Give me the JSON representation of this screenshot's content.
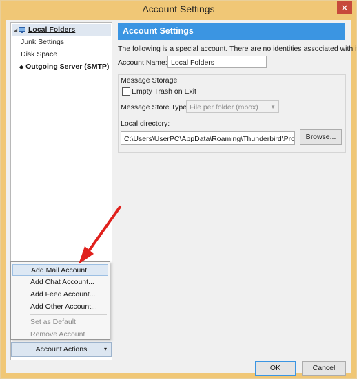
{
  "window": {
    "title": "Account Settings",
    "close_glyph": "✕"
  },
  "tree": {
    "items": [
      {
        "label": "Local Folders",
        "icon": "local-folder-icon"
      },
      {
        "label": "Junk Settings"
      },
      {
        "label": "Disk Space"
      },
      {
        "label": "Outgoing Server (SMTP)"
      }
    ],
    "twisty": "◢"
  },
  "menu": {
    "items": [
      {
        "label": "Add Mail Account..."
      },
      {
        "label": "Add Chat Account..."
      },
      {
        "label": "Add Feed Account..."
      },
      {
        "label": "Add Other Account..."
      },
      {
        "label": "Set as Default"
      },
      {
        "label": "Remove Account"
      }
    ]
  },
  "account_actions": {
    "label": "Account Actions",
    "arrow": "▾"
  },
  "panel": {
    "header": "Account Settings",
    "description": "The following is a special account. There are no identities associated with it.",
    "account_name_label": "Account Name:",
    "account_name_value": "Local Folders",
    "message_storage_label": "Message Storage",
    "empty_trash_label": "Empty Trash on Exit",
    "store_type_label": "Message Store Type:",
    "store_type_value": "File per folder (mbox)",
    "local_directory_label": "Local directory:",
    "local_directory_value": "C:\\Users\\UserPC\\AppData\\Roaming\\Thunderbird\\Profiles",
    "browse_label": "Browse..."
  },
  "footer": {
    "ok_label": "OK",
    "cancel_label": "Cancel"
  },
  "colors": {
    "accent": "#3b95e2",
    "titlebar": "#f0c776",
    "close": "#c74a3b",
    "arrow": "#e0201c"
  }
}
